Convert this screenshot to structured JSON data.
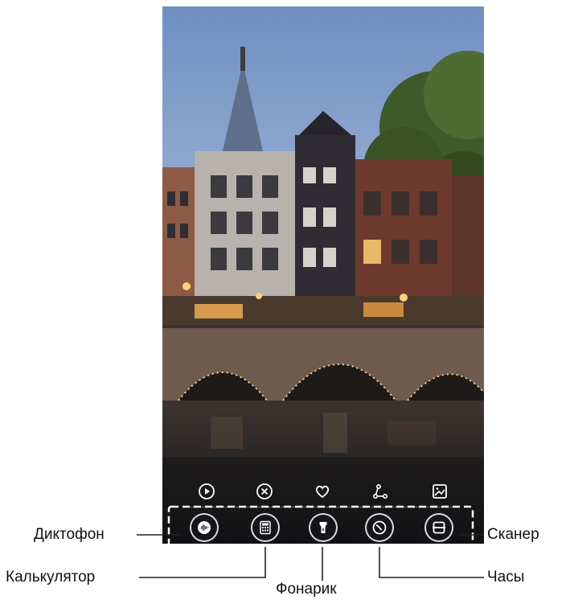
{
  "lock_screen": {
    "wallpaper": {
      "subject": "canal bridge at dusk with houses",
      "sky_color": "#8ea6cf",
      "water_color": "#2a2623"
    },
    "quick_actions": [
      {
        "icon": "play-circle-icon"
      },
      {
        "icon": "close-circle-icon"
      },
      {
        "icon": "heart-icon"
      },
      {
        "icon": "share-icon"
      },
      {
        "icon": "image-icon"
      }
    ],
    "shortcuts": [
      {
        "icon": "voice-recorder-icon"
      },
      {
        "icon": "calculator-icon"
      },
      {
        "icon": "flashlight-icon"
      },
      {
        "icon": "clock-icon"
      },
      {
        "icon": "scanner-icon"
      }
    ]
  },
  "callouts": {
    "voice_recorder": "Диктофон",
    "calculator": "Калькулятор",
    "flashlight": "Фонарик",
    "clock": "Часы",
    "scanner": "Сканер"
  },
  "colors": {
    "highlight_box": "#ffffff",
    "callout_line": "#222222"
  }
}
